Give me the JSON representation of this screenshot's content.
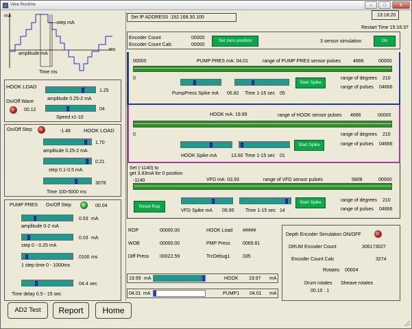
{
  "window": {
    "title": "View Runtime"
  },
  "top": {
    "ip_label": "Set  IP ADDRESS :192.168.30.100",
    "clock": "13:18:20",
    "restart": "Restart Time  15:16:37"
  },
  "waveform": {
    "ma": "mA",
    "step_ma": "step mA",
    "ms": "ms",
    "amplitude": "amplitude mA",
    "time_ms": "Time  ms"
  },
  "hook_load_panel": {
    "title": "HOOK LOAD",
    "onoff_wave": "On/Off Wave",
    "amp_value": "1.25",
    "amp_label": "amplitude 0.25-2 mA",
    "led_value": "00.12",
    "speed_value": "04",
    "speed_label": "Speed x1-10",
    "amp_level": 0.75,
    "speed_level": 0.45
  },
  "onoff_step_panel": {
    "onoff_step": "On/Off Step",
    "value": "-1.48",
    "hook_load": "HOOK LOAD",
    "amp_value": "1.70",
    "amp_label": "amplitude 0.25-2 mA",
    "step_value": "0.21",
    "step_label": "step 0.1-0.5 mA",
    "time_value": "3078",
    "time_label": "Time 100-5000 ms",
    "amp_level": 0.88,
    "step_level": 0.92,
    "time_level": 0.68
  },
  "pump_pres_panel": {
    "title": "PUMP PRES",
    "onoff_step": "On/Off Step",
    "value": "00.04",
    "amp_value": "0.53",
    "amp_unit": "mA",
    "amp_label": "amplitude 0-2 mA",
    "step_value": "0.03",
    "step_unit": "mA",
    "step_label": "step 0 - 0.25 mA",
    "step_time_value": "0100",
    "step_time_unit": "ms",
    "step_time_label": "1 step time 0 - 1000ms",
    "delay_value": "04.4",
    "delay_unit": "sec",
    "delay_label": "Time delay 0.5 - 15 sec",
    "amp_level": 0.26,
    "step_level": 0.14,
    "step_time_level": 0.1,
    "delay_level": 0.28
  },
  "buttons": {
    "ad2_test": "AD2 Test",
    "report": "Report",
    "home": "Home"
  },
  "encoder": {
    "count_label": "Encoder Count",
    "count_value": "00000",
    "calc_label": "Encoder Count Calc",
    "calc_value": "00000",
    "set_zero": "Set zero position",
    "sensor_sim": "3 sensor simulation",
    "on": "On"
  },
  "pump_section": {
    "left_num": "00000",
    "title": "PUMP PRES mA: 04.01",
    "range_label": "range of PUMP PRES sensor pulses",
    "range_val": "4666",
    "right_num": "00000",
    "zero": "0",
    "spike_label": "PumpPress Spike mA",
    "spike_value": "06.82",
    "time_label": "Time 1-15 sec",
    "time_value": "05",
    "start_spike": "Start Spike",
    "deg_label": "range of degrees",
    "deg_value": "210",
    "pulses_label": "range of pulses",
    "pulses_value": "04666",
    "spike_level": 0.35,
    "time_level": 0.33
  },
  "hook_section": {
    "title": "HOOK mA: 19.99",
    "range_label": "range of HOOK sensor pulses",
    "range_val": "4666",
    "right_num": "00000",
    "zero": "0",
    "spike_label": "HOOK Spike mA",
    "spike_value": "13.60",
    "time_label": "Time 1-15 sec",
    "time_value": "01",
    "start_spike": "Start Spike",
    "deg_label": "range of degrees",
    "deg_value": "210",
    "pulses_label": "range of pulses",
    "pulses_value": "04666",
    "spike_level": 0.6,
    "time_level": 0.06
  },
  "vfd_section": {
    "set_note_1": "Set (-1140) to",
    "set_note_2": "get 3.93mA for 0 position",
    "left_num": "-1140",
    "title": "VFD mA: 03.93",
    "range_label": "range of VFD sensor pulses",
    "range_val": "5808",
    "right_num": "00000",
    "reset_rop": "Reset Rop",
    "spike_label": "VFD Spike mA",
    "spike_value": "09.95",
    "time_label": "Time 1-15 sec",
    "time_value": "14",
    "start_spike": "Start Spike",
    "deg_label": "range of degrees",
    "deg_value": "210",
    "pulses_label": "range of pulses",
    "pulses_value": "04666",
    "spike_level": 0.62,
    "time_level": 0.92
  },
  "readouts": {
    "rop_label": "ROP",
    "rop_value": "00000.00",
    "wob_label": "WOB",
    "wob_value": "00000.00",
    "diff_label": "Diff Press",
    "diff_value": "00022.59",
    "hook_label": "HOOK Load",
    "hook_value": "#####",
    "pmp_label": "PMP Press",
    "pmp_value": "0069.81",
    "trc_label": "TrcDebug1",
    "trc_value": "035"
  },
  "bars": {
    "hook_left": "19.99",
    "hook_left_unit": "mA",
    "hook_name": "HOOK",
    "hook_right": "19.97",
    "hook_right_unit": "mA",
    "pump_left": "04.01",
    "pump_left_unit": "mA",
    "pump_name": "PUMP1",
    "pump_right": "04.01",
    "pump_right_unit": "mA",
    "hook_level": 0.999,
    "pump_level": 0.01
  },
  "depth_encoder": {
    "title": "Depth Encoder Simulation ON/OFF",
    "drum_label": "DRUM Encoder Count",
    "drum_value": "306173027",
    "calc_label": "Encoder Count Calc",
    "calc_value": "3274",
    "rotates_label": "Rotates",
    "rotates_value": "00004",
    "drum_rot_label": "Drum rotates",
    "sheave_label": "Sheave rotates",
    "ratio": "00.10 : 1"
  },
  "colors": {
    "panel": "#ece9d8",
    "pump_border": "#1a3a9c",
    "hook_border": "#a03a9c",
    "vfd_border": "#3a3a3a",
    "button_green": "#0aa84a",
    "track_green": "#2f8f2c"
  }
}
